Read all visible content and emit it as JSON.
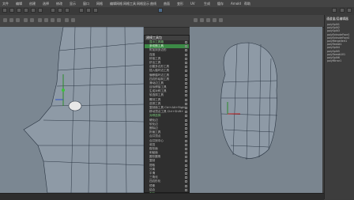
{
  "menubar": {
    "items": [
      "文件",
      "编辑",
      "创建",
      "选择",
      "修改",
      "显示",
      "窗口",
      "网格",
      "编辑网格",
      "网格工具",
      "网格显示",
      "曲线",
      "曲面",
      "变形",
      "UV",
      "生成",
      "缓存",
      "Arnold",
      "帮助"
    ]
  },
  "menu": {
    "title": "建模工具包",
    "items": [
      {
        "label": "显示工具箱",
        "style": "green"
      },
      {
        "label": "多切割工具",
        "style": "hl"
      },
      {
        "label": "附加到多边形",
        "style": ""
      },
      {
        "label": "连接",
        "style": ""
      },
      {
        "label": "桥接工具",
        "style": ""
      },
      {
        "label": "挤出工具",
        "style": ""
      },
      {
        "label": "创建多边形工具",
        "style": ""
      },
      {
        "label": "插入循环边工具",
        "style": ""
      },
      {
        "label": "偏移循环边工具",
        "style": ""
      },
      {
        "label": "四边形绘制工具",
        "style": ""
      },
      {
        "label": "滑动边工具",
        "style": ""
      },
      {
        "label": "目标焊接工具",
        "style": ""
      },
      {
        "label": "生成对称工具",
        "style": ""
      },
      {
        "label": "软选择工具",
        "style": ""
      },
      {
        "label": "雕刻工具",
        "style": ""
      },
      {
        "label": "选择工具",
        "style": ""
      },
      {
        "label": "复制面工具 Ctrl+Alt+Right",
        "style": ""
      },
      {
        "label": "移动顶点工具 Ctrl+Shift+",
        "style": ""
      },
      {
        "label": "对称选择",
        "style": "green"
      },
      {
        "label": "硬化边",
        "style": ""
      },
      {
        "label": "软化边",
        "style": ""
      },
      {
        "label": "删除边",
        "style": ""
      },
      {
        "label": "折痕工具",
        "style": ""
      },
      {
        "label": "合并顶点",
        "style": ""
      },
      {
        "label": "合并到中心",
        "style": ""
      },
      {
        "label": "收拢",
        "style": ""
      },
      {
        "label": "楔形面",
        "style": ""
      },
      {
        "label": "刺破面",
        "style": ""
      },
      {
        "label": "圆形圆角",
        "style": ""
      },
      {
        "label": "复制",
        "style": ""
      },
      {
        "label": "提取",
        "style": ""
      },
      {
        "label": "分离",
        "style": ""
      },
      {
        "label": "平滑",
        "style": ""
      },
      {
        "label": "三角化",
        "style": ""
      },
      {
        "label": "四边形化",
        "style": ""
      },
      {
        "label": "镜像",
        "style": ""
      },
      {
        "label": "结合",
        "style": ""
      },
      {
        "label": "布尔",
        "style": "green"
      },
      {
        "label": "清理",
        "style": ""
      }
    ]
  },
  "channel": {
    "title": "通道盒/层编辑器",
    "lines": [
      "polySplit1",
      "polySplit2",
      "polySplit3",
      "polyExtrudeFace1",
      "polyExtrudeFace2",
      "polyMergeVert1",
      "polyTweak1",
      "polySplit4",
      "polySplit5",
      "polyTweakUV1",
      "polySplit6",
      "polyMirror1"
    ]
  },
  "colors": {
    "accent": "#3c8a46",
    "viewport": "#7b8792",
    "mesh": "#8e9aa6",
    "wire": "#2a3542"
  }
}
